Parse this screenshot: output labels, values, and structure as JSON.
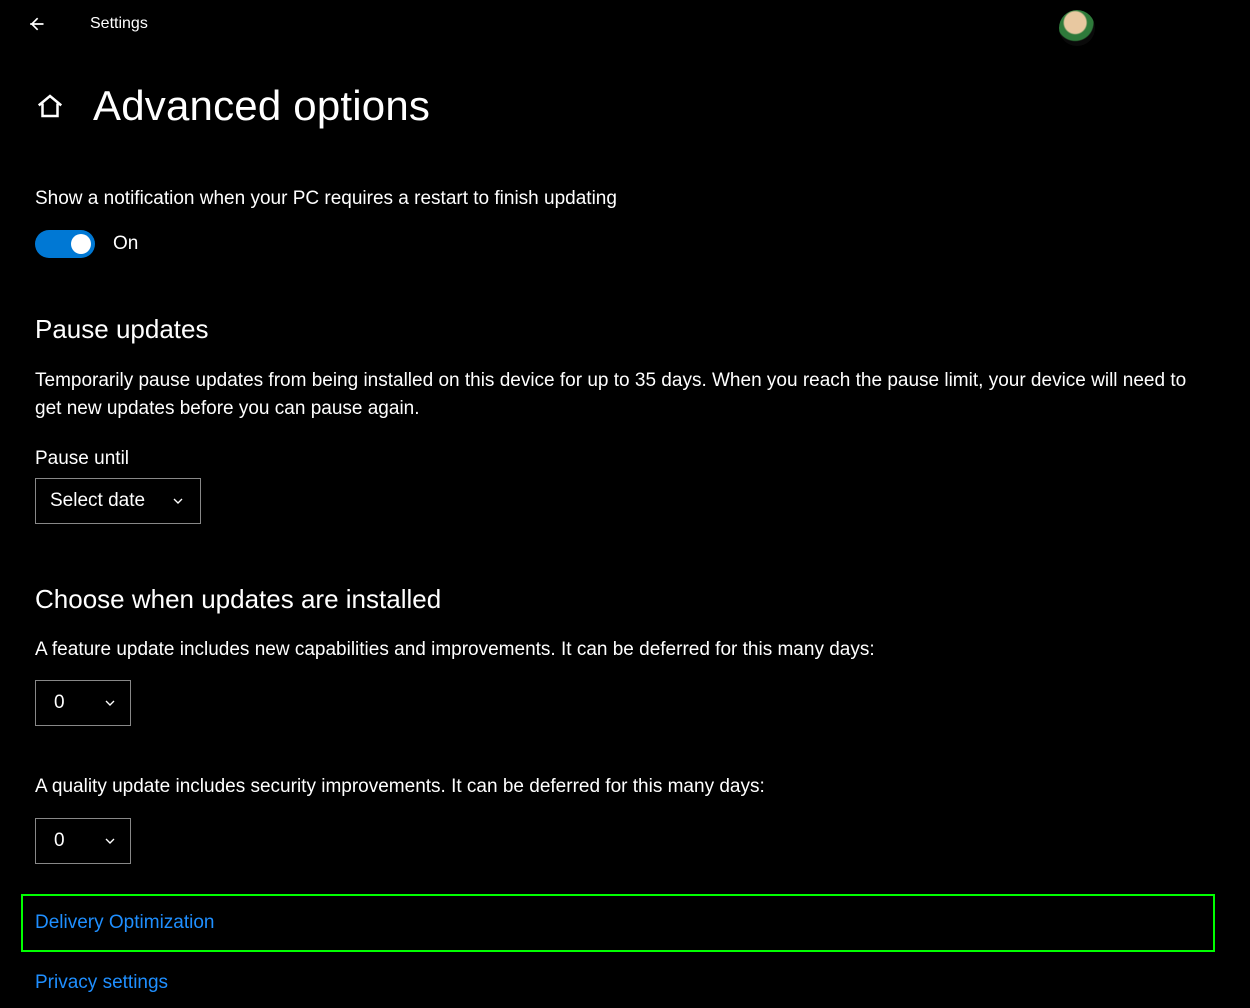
{
  "app": {
    "title": "Settings"
  },
  "page": {
    "title": "Advanced options"
  },
  "notify": {
    "label": "Show a notification when your PC requires a restart to finish updating",
    "state": "On"
  },
  "pause": {
    "heading": "Pause updates",
    "desc": "Temporarily pause updates from being installed on this device for up to 35 days. When you reach the pause limit, your device will need to get new updates before you can pause again.",
    "field_label": "Pause until",
    "value": "Select date"
  },
  "choose": {
    "heading": "Choose when updates are installed",
    "feature_label": "A feature update includes new capabilities and improvements. It can be deferred for this many days:",
    "feature_value": "0",
    "quality_label": "A quality update includes security improvements. It can be deferred for this many days:",
    "quality_value": "0"
  },
  "links": {
    "delivery": "Delivery Optimization",
    "privacy": "Privacy settings"
  }
}
